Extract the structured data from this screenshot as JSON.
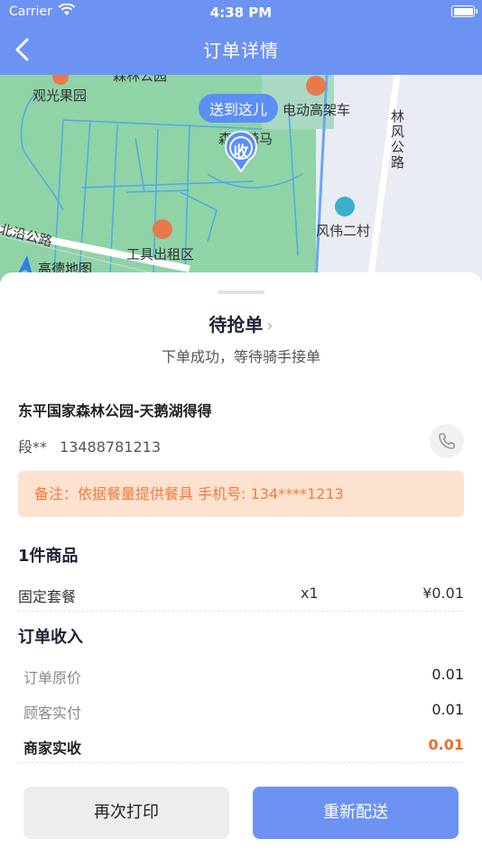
{
  "status_bar": {
    "carrier": "Carrier",
    "time": "4:38 PM"
  },
  "nav": {
    "title": "订单详情"
  },
  "map": {
    "pin_bubble": "送到这儿",
    "pin_marker": "收",
    "labels": {
      "forest_park": "森林公园",
      "orchard": "观光果园",
      "ebike": "电动高架车",
      "riding": "森林骑马",
      "linfeng_road": "林风公路",
      "beiyan_road": "北沿公路",
      "taxi": "工具出租区",
      "fengwei": "风伟二村",
      "amap": "高德地图"
    }
  },
  "order": {
    "status": "待抢单",
    "status_sub": "下单成功，等待骑手接单",
    "shop_name": "东平国家森林公园-天鹅湖得得",
    "customer_name": "段**",
    "customer_phone": "13488781213",
    "remark": "备注：依据餐量提供餐具 手机号: 134****1213"
  },
  "goods": {
    "header": "1件商品",
    "items": [
      {
        "name": "固定套餐",
        "qty": "x1",
        "price": "¥0.01"
      }
    ]
  },
  "income": {
    "header": "订单收入",
    "rows": [
      {
        "label": "订单原价",
        "value": "0.01"
      },
      {
        "label": "顾客实付",
        "value": "0.01"
      },
      {
        "label": "商家实收",
        "value": "0.01"
      }
    ]
  },
  "actions": {
    "print": "再次打印",
    "resend": "重新配送"
  },
  "colors": {
    "primary": "#6c93f2",
    "accent": "#f06a2b",
    "remark_bg": "#fde2cf",
    "map_green": "#8fd3a7"
  }
}
